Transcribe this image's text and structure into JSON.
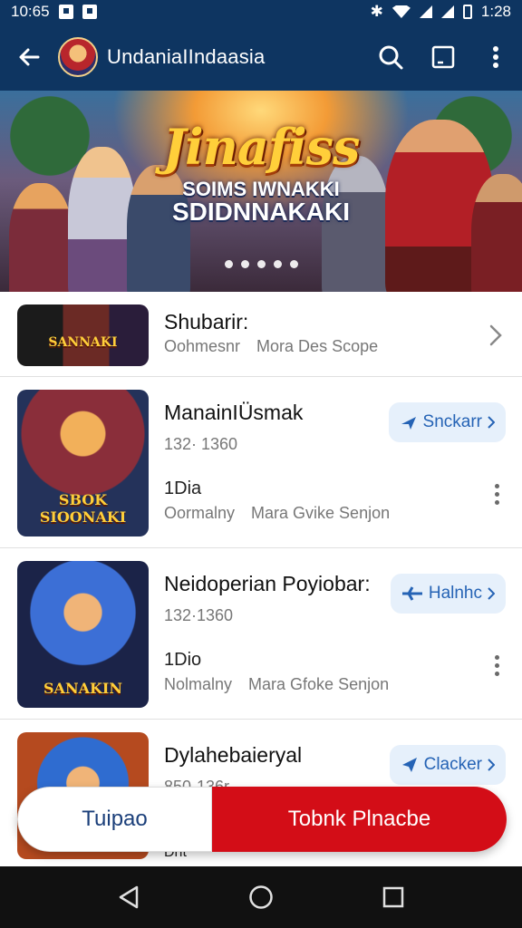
{
  "status_bar": {
    "time_left": "10:65",
    "time_right": "1:28"
  },
  "app_bar": {
    "title": "UndaniaIIndaasia",
    "icons": [
      "back-arrow-icon",
      "search-icon",
      "square-icon",
      "more-vert-icon"
    ]
  },
  "banner": {
    "title": "Jinafiss",
    "subtitle_line1": "SOIMS IWNAKKI",
    "subtitle_line2": "SDIDNNAKAKI",
    "page_count": 5,
    "active_page": 0
  },
  "items": [
    {
      "title": "Shubarir:",
      "meta_left": "Oohmesnr",
      "meta_right": "Mora Des Scope",
      "thumb_label": "SANNAKI"
    },
    {
      "title": "ManainIÜsmak",
      "sub": "132· 1360",
      "count": "1Dia",
      "meta_left": "Oormalny",
      "meta_right": "Mara Gvike Senjon",
      "action": "Snckarr",
      "thumb_label": "SBOK SIOONAKI"
    },
    {
      "title": "Neidoperian Poyiobar:",
      "sub": "132·1360",
      "count": "1Dio",
      "meta_left": "Nolmalny",
      "meta_right": "Mara Gfoke Senjon",
      "action": "Halnhc",
      "thumb_label": "SANAKIN"
    },
    {
      "title": "Dylahebaieryal",
      "sub": "850·136r",
      "count": "Dht",
      "action": "Clacker"
    }
  ],
  "bottom_bar": {
    "left_label": "Tuipao",
    "right_label": "Tobnk Plnacbe"
  },
  "colors": {
    "app_bar": "#0e3561",
    "primary_red": "#d30d17",
    "action_blue": "#2563b5"
  }
}
